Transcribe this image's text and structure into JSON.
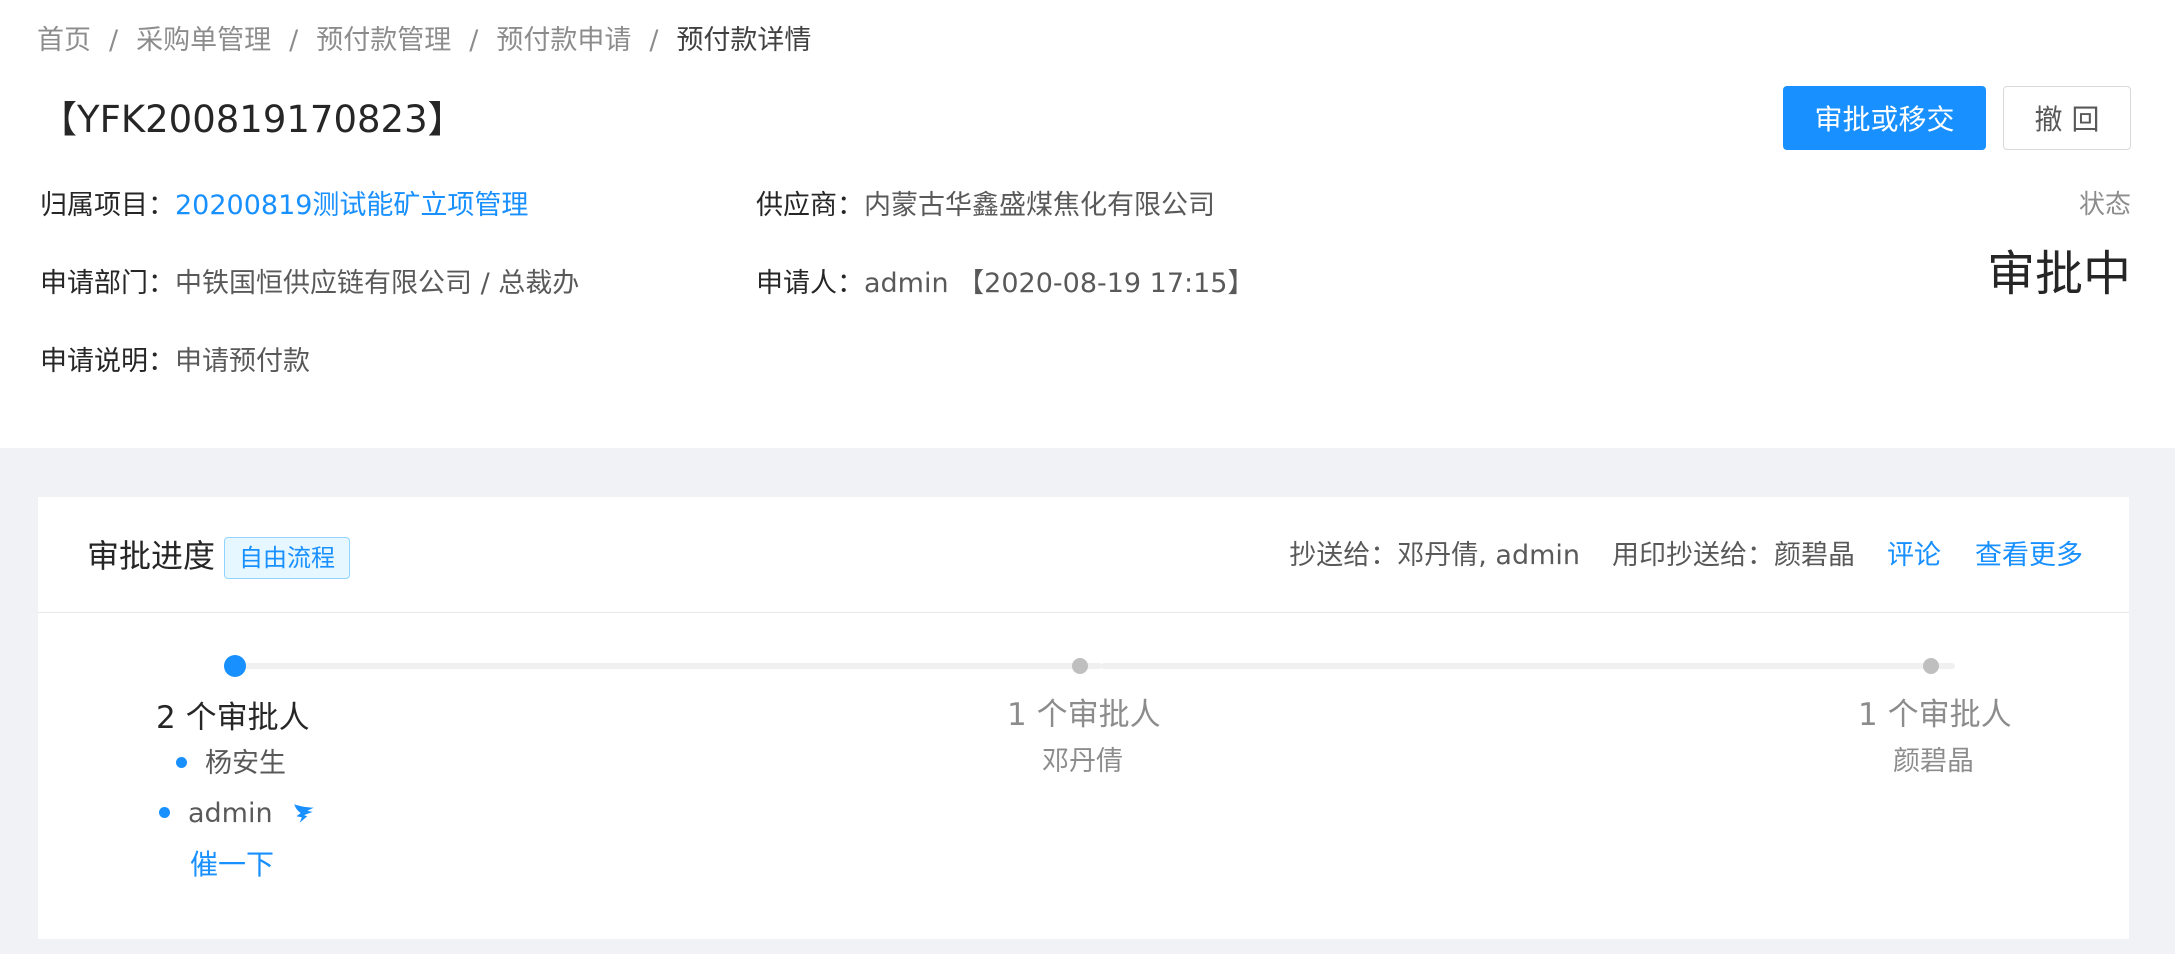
{
  "breadcrumb": {
    "items": [
      "首页",
      "采购单管理",
      "预付款管理",
      "预付款申请",
      "预付款详情"
    ],
    "separator": "/"
  },
  "header": {
    "title": "【YFK200819170823】",
    "approve_button": "审批或移交",
    "withdraw_button": "撤 回"
  },
  "details": {
    "project_label": "归属项目：",
    "project_value": "20200819测试能矿立项管理",
    "supplier_label": "供应商：",
    "supplier_value": "内蒙古华鑫盛煤焦化有限公司",
    "dept_label": "申请部门：",
    "dept_value": "中铁国恒供应链有限公司 / 总裁办",
    "applicant_label": "申请人：",
    "applicant_value": "admin 【2020-08-19 17:15】",
    "desc_label": "申请说明：",
    "desc_value": "申请预付款"
  },
  "status": {
    "label": "状态",
    "value": "审批中"
  },
  "progress": {
    "title": "审批进度",
    "tag": "自由流程",
    "cc_label": "抄送给：",
    "cc_value": "邓丹倩, admin",
    "seal_cc_label": "用印抄送给：",
    "seal_cc_value": "颜碧晶",
    "comment_link": "评论",
    "more_link": "查看更多",
    "steps": [
      {
        "count": "2 个审批人",
        "state": "active",
        "approvers": [
          "杨安生",
          "admin"
        ],
        "urge": "催一下"
      },
      {
        "count": "1 个审批人",
        "state": "wait",
        "person": "邓丹倩"
      },
      {
        "count": "1 个审批人",
        "state": "wait",
        "person": "颜碧晶"
      }
    ]
  },
  "colors": {
    "primary": "#1890ff",
    "background": "#f0f2f5",
    "dot_wait": "#bfbfbf"
  },
  "icons": {
    "dingtalk": "dingtalk-icon"
  }
}
